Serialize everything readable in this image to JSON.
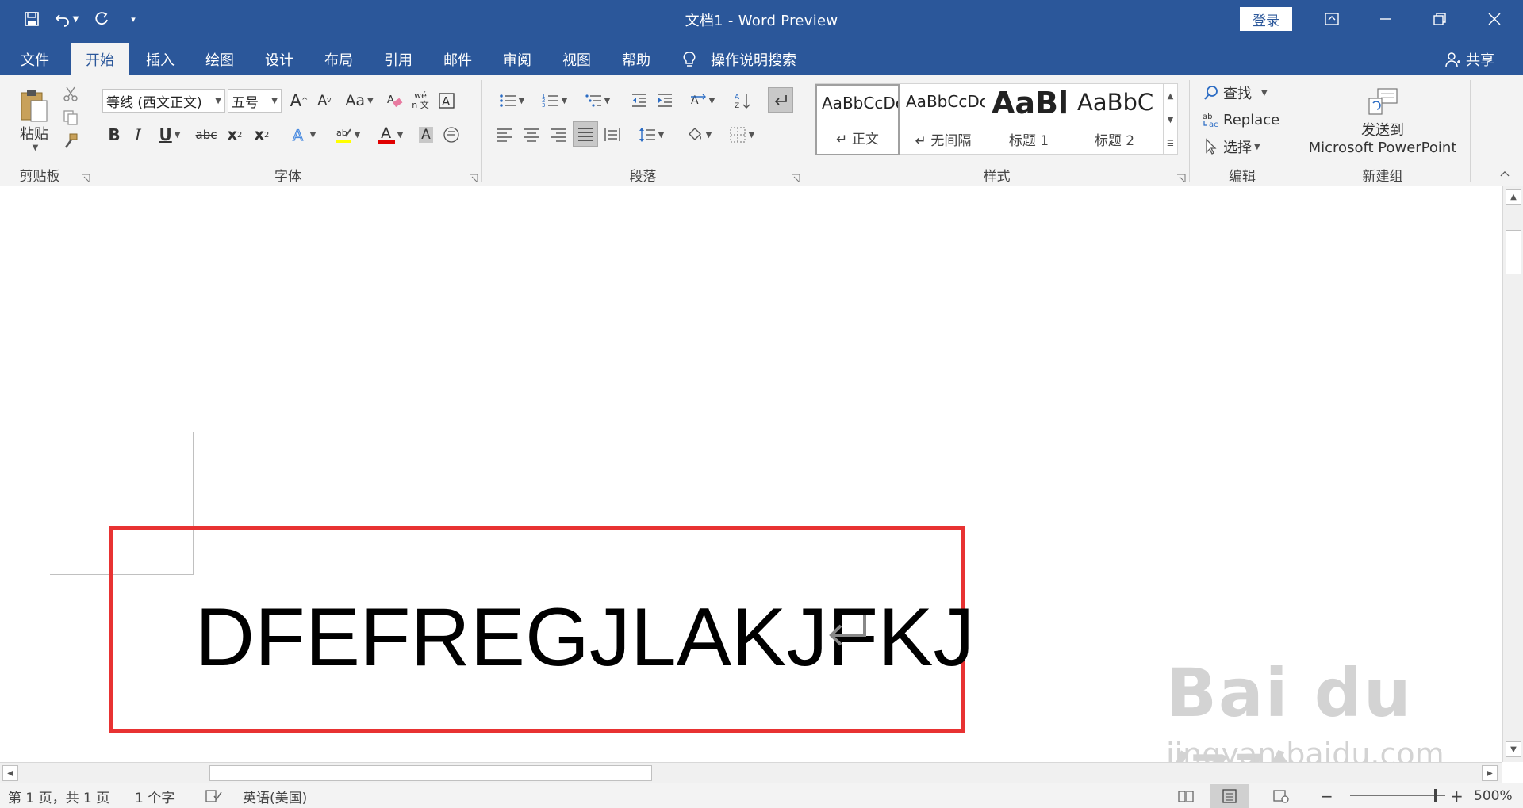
{
  "window": {
    "title": "文档1  -  Word Preview",
    "login_label": "登录"
  },
  "tabs": [
    {
      "label": "文件",
      "active": false
    },
    {
      "label": "开始",
      "active": true
    },
    {
      "label": "插入",
      "active": false
    },
    {
      "label": "绘图",
      "active": false
    },
    {
      "label": "设计",
      "active": false
    },
    {
      "label": "布局",
      "active": false
    },
    {
      "label": "引用",
      "active": false
    },
    {
      "label": "邮件",
      "active": false
    },
    {
      "label": "审阅",
      "active": false
    },
    {
      "label": "视图",
      "active": false
    },
    {
      "label": "帮助",
      "active": false
    }
  ],
  "tell_me": "操作说明搜索",
  "share": "共享",
  "ribbon": {
    "clipboard": {
      "label": "剪贴板",
      "paste_label": "粘贴"
    },
    "font": {
      "label": "字体",
      "font_name": "等线 (西文正文)",
      "font_size": "五号",
      "grow": "A",
      "shrink": "A",
      "change_case": "Aa",
      "bold": "B",
      "italic": "I",
      "underline": "U",
      "strikethrough": "abc",
      "subscript": "x",
      "superscript": "x",
      "font_color": "A",
      "char_shading": "A",
      "phonetic": "wén 文"
    },
    "paragraph": {
      "label": "段落"
    },
    "styles": {
      "label": "样式",
      "items": [
        {
          "sample": "AaBbCcDc",
          "name": "↵ 正文",
          "selected": true,
          "size": 20,
          "bold": false
        },
        {
          "sample": "AaBbCcDc",
          "name": "↵ 无间隔",
          "selected": false,
          "size": 20,
          "bold": false
        },
        {
          "sample": "AaBl",
          "name": "标题 1",
          "selected": false,
          "size": 38,
          "bold": true
        },
        {
          "sample": "AaBbC",
          "name": "标题 2",
          "selected": false,
          "size": 29,
          "bold": false
        }
      ]
    },
    "editing": {
      "label": "编辑",
      "find": "查找",
      "replace": "Replace",
      "select": "选择"
    },
    "new_group": {
      "label": "新建组",
      "send_line1": "发送到",
      "send_line2": "Microsoft PowerPoint"
    }
  },
  "document": {
    "text": "DFEFREGJLAKJFKJ"
  },
  "watermark": {
    "logo": "Bai du 经验",
    "url": "jingyan.baidu.com"
  },
  "status": {
    "page": "第 1 页，共 1 页",
    "words": "1 个字",
    "language": "英语(美国)",
    "zoom": "500%",
    "zoom_level": 0.9
  },
  "colors": {
    "brand": "#2b579a",
    "highlight_box": "#e83232",
    "ribbon_bg": "#f3f3f3"
  }
}
